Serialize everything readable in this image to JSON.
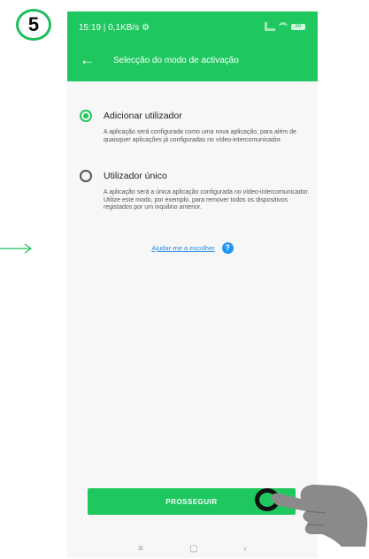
{
  "step_badge": "5",
  "status_bar": {
    "time_text": "15:19 | 0,1KB/s ⚙",
    "battery_text": "88"
  },
  "app_bar": {
    "back_icon": "←",
    "title": "Selecção do modo de activação"
  },
  "options": [
    {
      "label": "Adicionar utilizador",
      "description": "A aplicação será configurada como uma nova aplicação, para além de quaisquer aplicações já configuradas no vídeo-intercomunicador.",
      "selected": true
    },
    {
      "label": "Utilizador único",
      "description": "A aplicação será a única aplicação configurada no vídeo-intercomunicador. Utilize este modo, por exemplo, para remover todos os dispositivos registados por um inquilino anterior.",
      "selected": false
    }
  ],
  "help": {
    "link_text": "Ajudar-me a escolher",
    "icon_text": "?"
  },
  "proceed_button": "PROSSEGUIR",
  "nav_bar": {
    "menu_icon": "≡",
    "home_icon": "▢",
    "back_icon": "‹"
  },
  "colors": {
    "accent": "#1fc85f",
    "link": "#1e88e5",
    "badge_border": "#1fbd5c"
  }
}
